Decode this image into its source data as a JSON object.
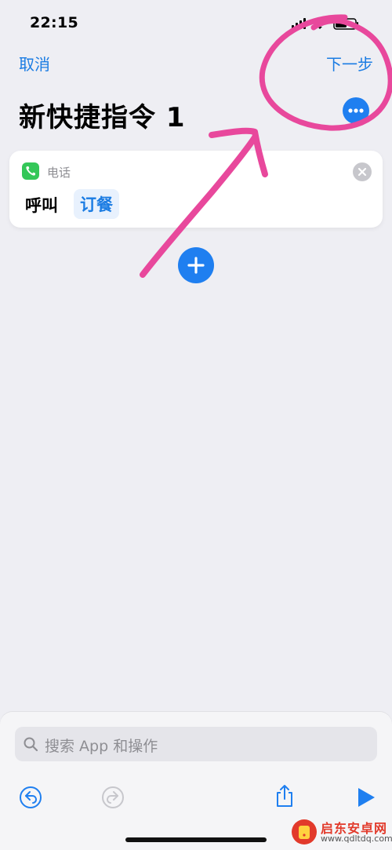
{
  "status_bar": {
    "time": "22:15"
  },
  "nav": {
    "cancel_label": "取消",
    "next_label": "下一步"
  },
  "page": {
    "title": "新快捷指令 1"
  },
  "action_card": {
    "app_label": "电话",
    "action_label": "呼叫",
    "contact_token": "订餐"
  },
  "search": {
    "placeholder": "搜索 App 和操作"
  },
  "icons": {
    "more": "ellipsis-icon",
    "phone": "phone-icon",
    "close": "close-icon",
    "add": "plus-icon",
    "search": "search-icon",
    "undo": "undo-icon",
    "redo": "redo-icon",
    "share": "share-icon",
    "run": "play-icon"
  },
  "colors": {
    "accent": "#1f7ff0",
    "link": "#1b7ce3",
    "phone_app": "#34c759",
    "annotation": "#e8489c",
    "background": "#eeeef3"
  },
  "watermark": {
    "text": "启东安卓网",
    "url": "www.qdltdq.com"
  }
}
